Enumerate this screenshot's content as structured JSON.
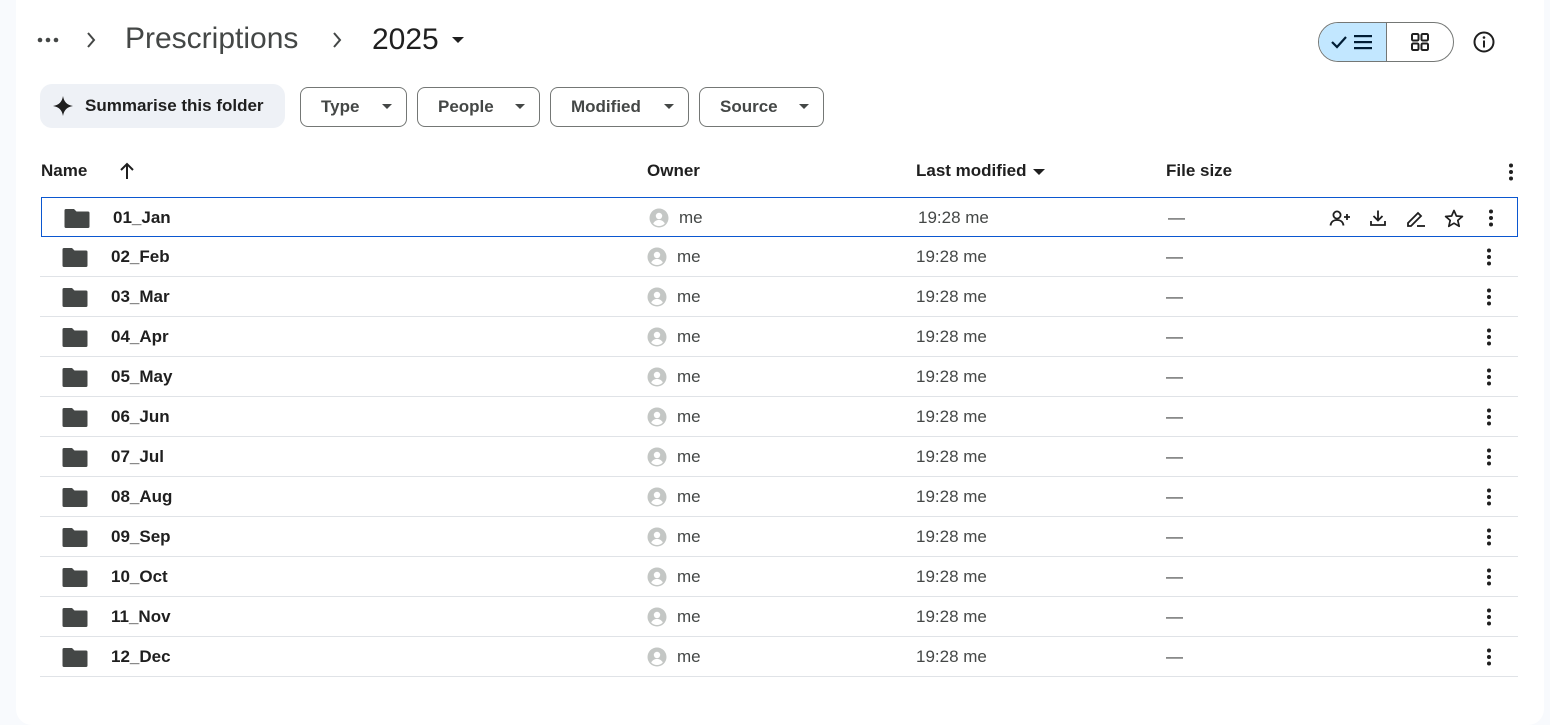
{
  "breadcrumb": {
    "more_icon": "more-horiz-icon",
    "parent": "Prescriptions",
    "current": "2025"
  },
  "view_toggle": {
    "list_icon": "check-list-icon",
    "grid_icon": "grid-icon",
    "active": "list"
  },
  "info_icon": "info-icon",
  "chips": {
    "summarise": "Summarise this folder",
    "type": "Type",
    "people": "People",
    "modified": "Modified",
    "source": "Source"
  },
  "table": {
    "headers": {
      "name": "Name",
      "owner": "Owner",
      "last_modified": "Last modified",
      "file_size": "File size"
    },
    "rows": [
      {
        "name": "01_Jan",
        "owner": "me",
        "modified": "19:28 me",
        "size": "—"
      },
      {
        "name": "02_Feb",
        "owner": "me",
        "modified": "19:28 me",
        "size": "—"
      },
      {
        "name": "03_Mar",
        "owner": "me",
        "modified": "19:28 me",
        "size": "—"
      },
      {
        "name": "04_Apr",
        "owner": "me",
        "modified": "19:28 me",
        "size": "—"
      },
      {
        "name": "05_May",
        "owner": "me",
        "modified": "19:28 me",
        "size": "—"
      },
      {
        "name": "06_Jun",
        "owner": "me",
        "modified": "19:28 me",
        "size": "—"
      },
      {
        "name": "07_Jul",
        "owner": "me",
        "modified": "19:28 me",
        "size": "—"
      },
      {
        "name": "08_Aug",
        "owner": "me",
        "modified": "19:28 me",
        "size": "—"
      },
      {
        "name": "09_Sep",
        "owner": "me",
        "modified": "19:28 me",
        "size": "—"
      },
      {
        "name": "10_Oct",
        "owner": "me",
        "modified": "19:28 me",
        "size": "—"
      },
      {
        "name": "11_Nov",
        "owner": "me",
        "modified": "19:28 me",
        "size": "—"
      },
      {
        "name": "12_Dec",
        "owner": "me",
        "modified": "19:28 me",
        "size": "—"
      }
    ],
    "row_actions": [
      "share-icon",
      "download-icon",
      "rename-icon",
      "star-icon"
    ]
  },
  "colors": {
    "accent": "#c2e7ff",
    "selected_border": "#0b57d0",
    "folder": "#444746"
  }
}
